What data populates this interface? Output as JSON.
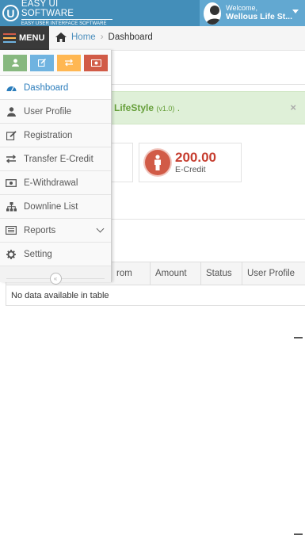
{
  "header": {
    "logo_glyph": "U",
    "logo_title": "EASY UI SOFTWARE",
    "logo_subtitle": "EASY USER INTERFACE SOFTWARE",
    "welcome_label": "Welcome,",
    "user_name": "Wellous Life St...",
    "brand_color": "#438eb9"
  },
  "menu_button": {
    "label": "MENU"
  },
  "breadcrumb": {
    "home": "Home",
    "current": "Dashboard"
  },
  "shortcuts": [
    {
      "icon": "user-icon",
      "color": "#87b87f"
    },
    {
      "icon": "edit-icon",
      "color": "#6fb3e0"
    },
    {
      "icon": "exchange-icon",
      "color": "#ffb752"
    },
    {
      "icon": "money-icon",
      "color": "#d15b47"
    }
  ],
  "sidebar": {
    "items": [
      {
        "label": "Dashboard",
        "icon": "dashboard-icon"
      },
      {
        "label": "User Profile",
        "icon": "user-icon"
      },
      {
        "label": "Registration",
        "icon": "edit-icon"
      },
      {
        "label": "Transfer E-Credit",
        "icon": "exchange-icon"
      },
      {
        "label": "E-Withdrawal",
        "icon": "money-icon"
      },
      {
        "label": "Downline List",
        "icon": "sitemap-icon"
      },
      {
        "label": "Reports",
        "icon": "list-icon"
      },
      {
        "label": "Setting",
        "icon": "gear-icon"
      }
    ],
    "collapse_glyph": "«"
  },
  "alert": {
    "text": "LifeStyle",
    "version": "(v1.0)",
    "trail": ".",
    "close": "×"
  },
  "stat": {
    "value": "200.00",
    "label": "E-Credit"
  },
  "table": {
    "headers": [
      "rom",
      "Amount",
      "Status",
      "User Profile"
    ],
    "empty_text": "No data available in table"
  }
}
